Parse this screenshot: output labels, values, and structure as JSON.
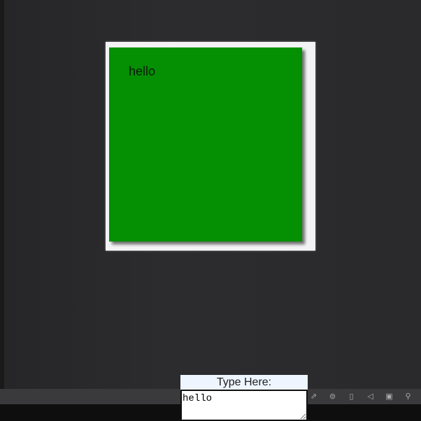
{
  "card": {
    "text": "hello",
    "color": "#058f03"
  },
  "input_widget": {
    "label": "Type Here:",
    "value": "hello"
  },
  "tray": {
    "icons": [
      "notification-icon",
      "network-icon",
      "battery-icon",
      "volume-icon",
      "window-icon",
      "search-icon"
    ]
  }
}
